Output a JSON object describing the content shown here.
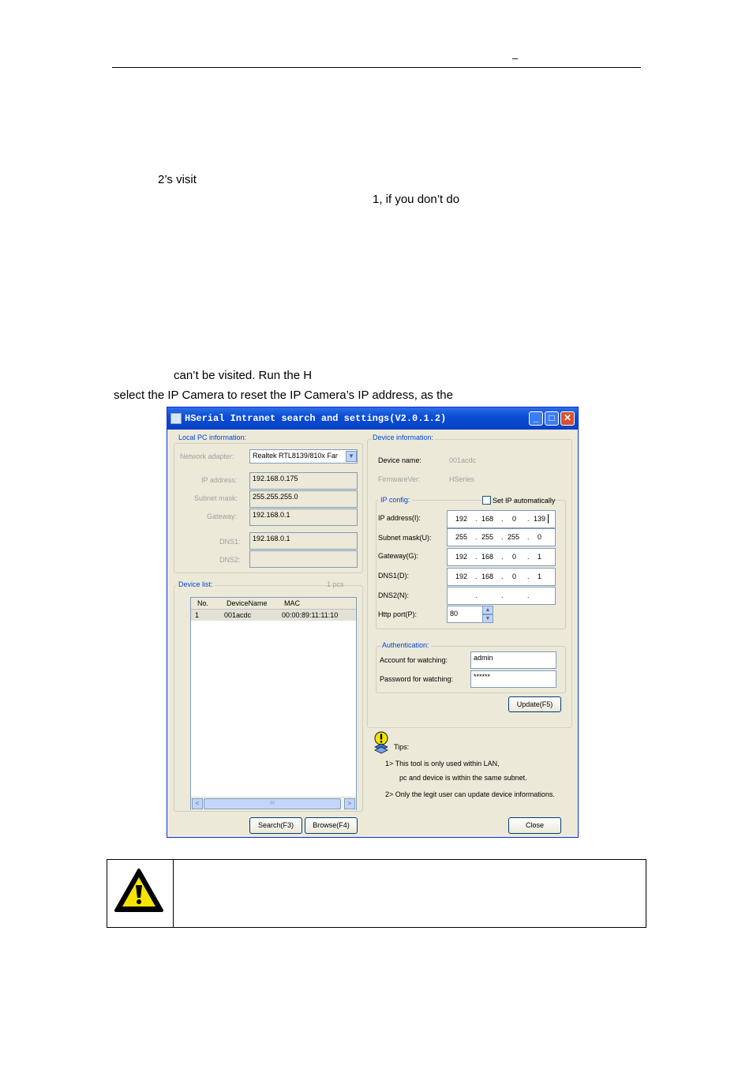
{
  "header": {
    "mark": "–"
  },
  "body": {
    "line1": "2’s  visit",
    "line2": "1,  if  you  don’t  do",
    "line3": "can’t be visited. Run the H",
    "line4": "select the IP Camera to reset the IP Camera’s IP address, as the"
  },
  "window": {
    "title": "HSerial  Intranet  search  and  settings(V2.0.1.2)",
    "controls": {
      "minimize": "_",
      "maximize": "□",
      "close": "✕"
    },
    "local_pc": {
      "title": "Local PC information:",
      "adapter_label": "Network adapter:",
      "adapter_value": "Realtek RTL8139/810x Far",
      "ip_label": "IP address:",
      "ip_value": "192.168.0.175",
      "mask_label": "Subnet mask:",
      "mask_value": "255.255.255.0",
      "gateway_label": "Gateway:",
      "gateway_value": "192.168.0.1",
      "dns1_label": "DNS1:",
      "dns1_value": "192.168.0.1",
      "dns2_label": "DNS2:",
      "dns2_value": ""
    },
    "device_list": {
      "title": "Device list:",
      "count": "1 pcs",
      "columns": [
        "No.",
        "DeviceName",
        "MAC"
      ],
      "rows": [
        {
          "no": "1",
          "name": "001acdc",
          "mac": "00:00:89:11:11:10"
        }
      ],
      "scroll_left": "<",
      "scroll_right": ">",
      "scroll_grip": "III"
    },
    "device_info": {
      "title": "Device information:",
      "name_label": "Device name:",
      "name_value": "001acdc",
      "fw_label": "FirmwareVer:",
      "fw_value": "HSeries"
    },
    "ip_config": {
      "title": "IP config:",
      "auto_label": "Set IP automatically",
      "auto_checked": false,
      "ip_label": "IP address(I):",
      "ip": [
        "192",
        "168",
        "0",
        "139"
      ],
      "mask_label": "Subnet mask(U):",
      "mask": [
        "255",
        "255",
        "255",
        "0"
      ],
      "gateway_label": "Gateway(G):",
      "gateway": [
        "192",
        "168",
        "0",
        "1"
      ],
      "dns1_label": "DNS1(D):",
      "dns1": [
        "192",
        "168",
        "0",
        "1"
      ],
      "dns2_label": "DNS2(N):",
      "dns2": [
        "",
        "",
        "",
        ""
      ],
      "port_label": "Http port(P):",
      "port_value": "80"
    },
    "auth": {
      "title": "Authentication:",
      "account_label": "Account for watching:",
      "account_value": "admin",
      "password_label": "Password for watching:",
      "password_value": "******"
    },
    "buttons": {
      "update": "Update(F5)",
      "search": "Search(F3)",
      "browse": "Browse(F4)",
      "close": "Close"
    },
    "tips": {
      "title": "Tips:",
      "tip1": "1> This tool is only used within LAN,",
      "tip1b": "pc and device is within the same subnet.",
      "tip2": "2> Only the legit user can update  device informations."
    }
  },
  "colors": {
    "titlebar": "#0a4ed6",
    "group_title": "#0046d5",
    "window_bg": "#ece9d8",
    "warning_yellow": "#f5e400"
  }
}
